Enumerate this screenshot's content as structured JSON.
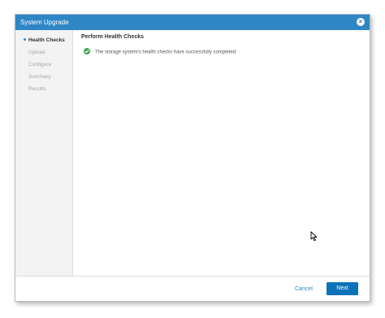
{
  "dialog": {
    "title": "System Upgrade",
    "close_icon": "close-circle-icon"
  },
  "steps": [
    {
      "label": "Health Checks",
      "active": true
    },
    {
      "label": "Upload",
      "active": false
    },
    {
      "label": "Configure",
      "active": false
    },
    {
      "label": "Summary",
      "active": false
    },
    {
      "label": "Results",
      "active": false
    }
  ],
  "content": {
    "title": "Perform Health Checks",
    "status_icon": "check-circle-icon",
    "status_message": "The storage system's health checks have successfully completed"
  },
  "footer": {
    "cancel_label": "Cancel",
    "next_label": "Next"
  },
  "colors": {
    "accent": "#2f86c5",
    "primary_button": "#0c73b8",
    "success": "#3aa552"
  }
}
